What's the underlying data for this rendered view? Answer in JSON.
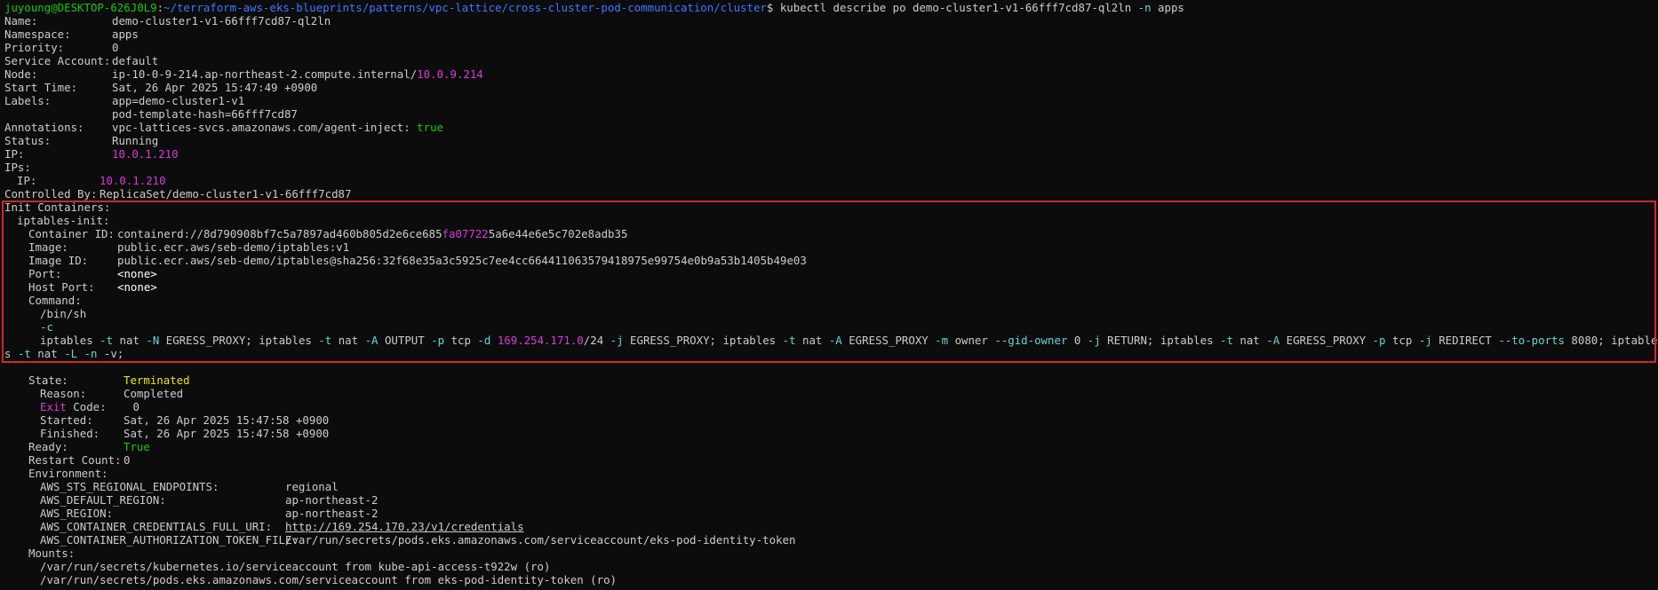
{
  "prompt": {
    "userhost": "juyoung@DESKTOP-626J0L9",
    "colon": ":",
    "path": "~/terraform-aws-eks-blueprints/patterns/vpc-lattice/cross-cluster-pod-communication/cluster",
    "dollar": "$ ",
    "cmd_a": "kubectl describe po demo-cluster1-v1-66fff7cd87-ql2ln ",
    "cmd_flag": "-n",
    "cmd_b": " apps"
  },
  "pod": {
    "name": "demo-cluster1-v1-66fff7cd87-ql2ln",
    "namespace": "apps",
    "priority": "0",
    "service_account": "default",
    "node_prefix": "ip-10-0-9-214.ap-northeast-2.compute.internal/",
    "node_ip": "10.0.9.214",
    "start_time": "Sat, 26 Apr 2025 15:47:49 +0900",
    "label1": "app=demo-cluster1-v1",
    "label2": "pod-template-hash=66fff7cd87",
    "annotation_key": "vpc-lattices-svcs.amazonaws.com/agent-inject: ",
    "annotation_val": "true",
    "status": "Running",
    "ip": "10.0.1.210",
    "ips_ip": "10.0.1.210",
    "controlled_by": "ReplicaSet/demo-cluster1-v1-66fff7cd87"
  },
  "init": {
    "container_name": "iptables-init:",
    "container_id_a": "containerd://8d790908bf7c5a7897ad460b805d2e6ce685",
    "container_id_b": "fa07722",
    "container_id_c": "5a6e44e6e5c702e8adb35",
    "image": "public.ecr.aws/seb-demo/iptables:v1",
    "image_id": "public.ecr.aws/seb-demo/iptables@sha256:32f68e35a3c5925c7ee4cc664411063579418975e99754e0b9a53b1405b49e03",
    "port": "<none>",
    "host_port": "<none>",
    "cmd1": "/bin/sh",
    "cmd2": "-c",
    "cmd3_parts": [
      "iptables ",
      "-t",
      " nat ",
      "-N",
      " EGRESS_PROXY; iptables ",
      "-t",
      " nat ",
      "-A",
      " OUTPUT ",
      "-p",
      " tcp ",
      "-d",
      " ",
      "169.254.171.0",
      "/24 ",
      "-j",
      " EGRESS_PROXY; iptables ",
      "-t",
      " nat ",
      "-A",
      " EGRESS_PROXY ",
      "-m",
      " owner ",
      "--gid-owner",
      " 0 ",
      "-j",
      " RETURN; iptables ",
      "-t",
      " nat ",
      "-A",
      " EGRESS_PROXY ",
      "-p",
      " tcp ",
      "-j",
      " REDIRECT ",
      "--to-ports",
      " 8080; iptables ",
      "-t",
      " nat ",
      "-L",
      " ",
      "-n",
      " -v;"
    ]
  },
  "state": {
    "state": "Terminated",
    "reason": "Completed",
    "exit_word": "Exit",
    "exit_rest": " Code:    ",
    "exit_code": "0",
    "started": "Sat, 26 Apr 2025 15:47:58 +0900",
    "finished": "Sat, 26 Apr 2025 15:47:58 +0900",
    "ready": "True",
    "restart_count": "0"
  },
  "env": [
    {
      "key": "AWS_STS_REGIONAL_ENDPOINTS:",
      "val": "regional"
    },
    {
      "key": "AWS_DEFAULT_REGION:",
      "val": "ap-northeast-2"
    },
    {
      "key": "AWS_REGION:",
      "val": "ap-northeast-2"
    },
    {
      "key": "AWS_CONTAINER_CREDENTIALS_FULL_URI:",
      "val": "http://169.254.170.23/v1/credentials"
    },
    {
      "key": "AWS_CONTAINER_AUTHORIZATION_TOKEN_FILE:",
      "val": "/var/run/secrets/pods.eks.amazonaws.com/serviceaccount/eks-pod-identity-token"
    }
  ],
  "mounts": [
    "/var/run/secrets/kubernetes.io/serviceaccount from kube-api-access-t922w (ro)",
    "/var/run/secrets/pods.eks.amazonaws.com/serviceaccount from eks-pod-identity-token (ro)"
  ],
  "labels": {
    "name": "Name:",
    "namespace": "Namespace:",
    "priority": "Priority:",
    "service_account": "Service Account:",
    "node": "Node:",
    "start_time": "Start Time:",
    "labels": "Labels:",
    "annotations": "Annotations:",
    "status": "Status:",
    "ip": "IP:",
    "ips": "IPs:",
    "ips_ip": "IP:",
    "controlled_by": "Controlled By:",
    "init_containers": "Init Containers:",
    "container_id": "Container ID:",
    "image": "Image:",
    "image_id": "Image ID:",
    "port": "Port:",
    "host_port": "Host Port:",
    "command": "Command:",
    "state": "State:",
    "reason": "Reason:",
    "started": "Started:",
    "finished": "Finished:",
    "ready": "Ready:",
    "restart_count": "Restart Count:",
    "environment": "Environment:",
    "mounts": "Mounts:"
  },
  "colors": {
    "background": "#0c0c0c",
    "text": "#cccccc",
    "prompt_green": "#16c60c",
    "path_blue": "#3b78ff",
    "ip_magenta": "#d63bdb",
    "flag_cyan": "#61d6d6",
    "highlight_red": "#d0282a"
  }
}
